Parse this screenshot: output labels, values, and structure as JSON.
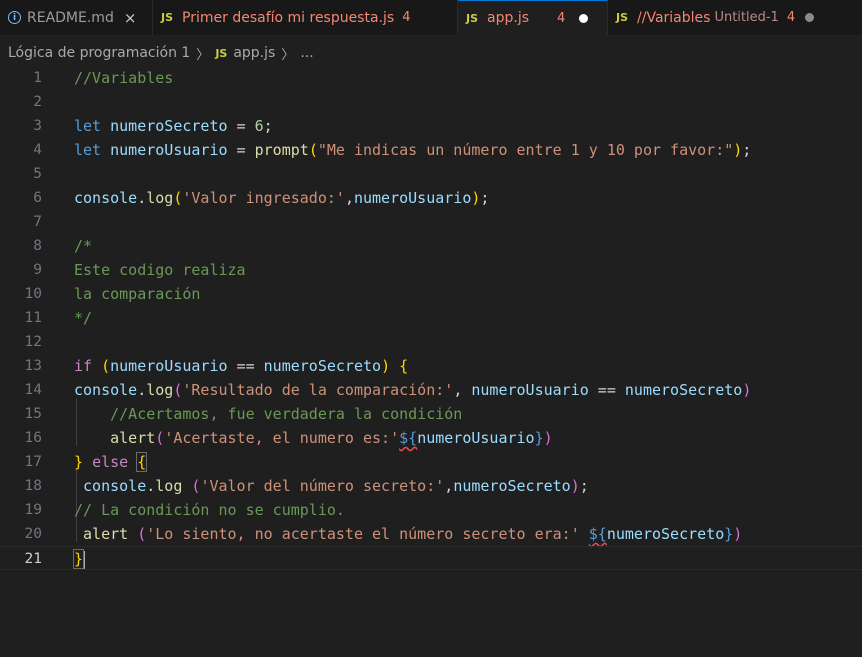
{
  "tabs": [
    {
      "icon": "info-icon",
      "label": "README.md",
      "close": "×"
    },
    {
      "icon": "js-icon",
      "icon_text": "JS",
      "label": "Primer desafío mi respuesta.js",
      "badge": "4"
    },
    {
      "icon": "js-icon",
      "icon_text": "JS",
      "label": "app.js",
      "badge": "4",
      "active": true
    },
    {
      "icon": "js-icon",
      "icon_text": "JS",
      "label": "//Variables",
      "sublabel": "Untitled-1",
      "badge": "4"
    }
  ],
  "breadcrumb": {
    "folder": "Lógica de programación 1",
    "file_icon": "JS",
    "file": "app.js",
    "more": "..."
  },
  "editor": {
    "line_numbers": [
      "1",
      "2",
      "3",
      "4",
      "5",
      "6",
      "7",
      "8",
      "9",
      "10",
      "11",
      "12",
      "13",
      "14",
      "15",
      "16",
      "17",
      "18",
      "19",
      "20",
      "21"
    ],
    "current_line": "21",
    "code": {
      "l1": "//Variables",
      "l3": {
        "kw": "let",
        "var": "numeroSecreto",
        "op": " = ",
        "num": "6",
        "end": ";"
      },
      "l4": {
        "kw": "let",
        "var": "numeroUsuario",
        "op": " = ",
        "fn": "prompt",
        "str": "\"Me indicas un número entre 1 y 10 por favor:\"",
        "end": ";"
      },
      "l6": {
        "obj": "console",
        "fn": "log",
        "str": "'Valor ingresado:'",
        "sep": ",",
        "var": "numeroUsuario",
        "end": ";"
      },
      "l8": "/*",
      "l9": "Este codigo realiza",
      "l10": "la comparación",
      "l11": "*/",
      "l13": {
        "kw": "if",
        "var1": "numeroUsuario",
        "op": " == ",
        "var2": "numeroSecreto"
      },
      "l14": {
        "obj": "console",
        "fn": "log",
        "str": "'Resultado de la comparación:'",
        "sep": ", ",
        "var1": "numeroUsuario",
        "op": " == ",
        "var2": "numeroSecreto"
      },
      "l15": "//Acertamos, fue verdadera la condición",
      "l16": {
        "fn": "alert",
        "str": "'Acertaste, el numero es:'",
        "tpl": "${",
        "var": "numeroUsuario",
        "tpl_end": "}"
      },
      "l17": {
        "kw": "else"
      },
      "l18": {
        "obj": "console",
        "fn": "log",
        "str": "'Valor del número secreto:'",
        "sep": ",",
        "var": "numeroSecreto",
        "end": ";"
      },
      "l19": "// La condición no se cumplio.",
      "l20": {
        "fn": "alert",
        "str": "'Lo siento, no acertaste el número secreto era:'",
        "tpl": "${",
        "var": "numeroSecreto",
        "tpl_end": "}"
      },
      "l21": "}"
    }
  },
  "colors": {
    "background": "#1f1f1f",
    "keyword": "#569cd6",
    "control": "#c586c0",
    "variable": "#9cdcfe",
    "function": "#dcdcaa",
    "string": "#ce9178",
    "number": "#b5cea8",
    "comment": "#6a9955",
    "js_icon": "#cbcb41"
  }
}
